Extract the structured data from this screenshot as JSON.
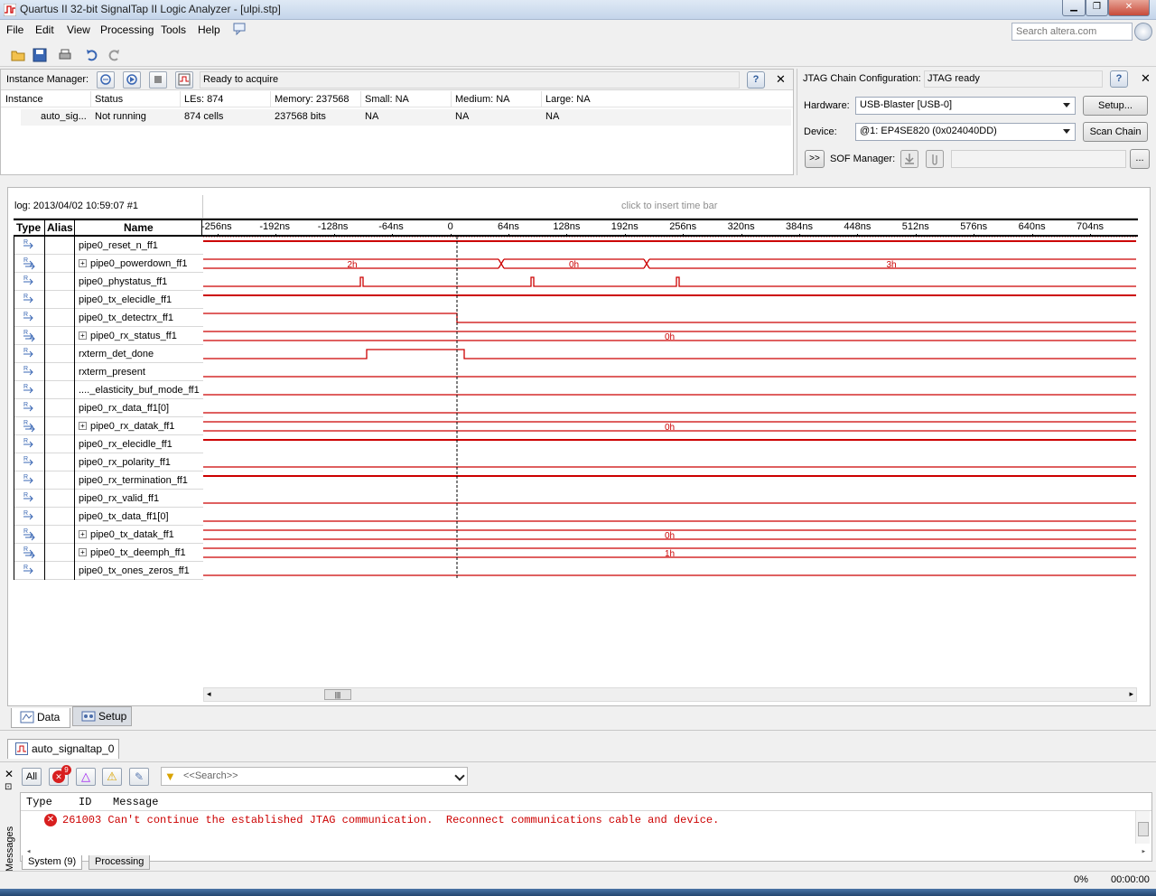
{
  "window": {
    "title": "Quartus II 32-bit SignalTap II Logic Analyzer - [ulpi.stp]",
    "search_placeholder": "Search altera.com"
  },
  "menu": {
    "file": "File",
    "edit": "Edit",
    "view": "View",
    "processing": "Processing",
    "tools": "Tools",
    "help": "Help"
  },
  "instance_manager": {
    "label": "Instance Manager:",
    "status": "Ready to acquire",
    "columns": {
      "instance": "Instance",
      "status": "Status",
      "les": "LEs: 874",
      "memory": "Memory: 237568",
      "small": "Small: NA",
      "medium": "Medium: NA",
      "large": "Large: NA"
    },
    "row": {
      "instance": "auto_sig...",
      "status": "Not running",
      "les": "874 cells",
      "memory": "237568 bits",
      "small": "NA",
      "medium": "NA",
      "large": "NA"
    }
  },
  "jtag": {
    "label": "JTAG Chain Configuration:",
    "status": "JTAG ready",
    "hardware_label": "Hardware:",
    "hardware_value": "USB-Blaster [USB-0]",
    "setup_button": "Setup...",
    "device_label": "Device:",
    "device_value": "@1: EP4SE820 (0x024040DD)",
    "scan_button": "Scan Chain",
    "sof_expand": ">>",
    "sof_label": "SOF Manager:",
    "browse_button": "..."
  },
  "waveform": {
    "log_label": "log: 2013/04/02 10:59:07  #1",
    "timebar_hint": "click to insert time bar",
    "headers": {
      "type": "Type",
      "alias": "Alias",
      "name": "Name"
    },
    "ticks": [
      "-256ns",
      "-192ns",
      "-128ns",
      "-64ns",
      "0",
      "64ns",
      "128ns",
      "192ns",
      "256ns",
      "320ns",
      "384ns",
      "448ns",
      "512ns",
      "576ns",
      "640ns",
      "704ns"
    ],
    "signals": [
      {
        "name": "pipe0_reset_n_ff1",
        "bus": false,
        "wave": "high"
      },
      {
        "name": "pipe0_powerdown_ff1",
        "bus": true,
        "segments": [
          {
            "label": "2h"
          },
          {
            "label": "0h"
          },
          {
            "label": "3h"
          }
        ]
      },
      {
        "name": "pipe0_phystatus_ff1",
        "bus": false,
        "wave": "pulses"
      },
      {
        "name": "pipe0_tx_elecidle_ff1",
        "bus": false,
        "wave": "high"
      },
      {
        "name": "pipe0_tx_detectrx_ff1",
        "bus": false,
        "wave": "high-then-low"
      },
      {
        "name": "pipe0_rx_status_ff1",
        "bus": true,
        "segments": [
          {
            "label": "0h"
          }
        ]
      },
      {
        "name": "rxterm_det_done",
        "bus": false,
        "wave": "pulse-wide"
      },
      {
        "name": "rxterm_present",
        "bus": false,
        "wave": "low"
      },
      {
        "name": "...._elasticity_buf_mode_ff1",
        "bus": false,
        "wave": "low"
      },
      {
        "name": "pipe0_rx_data_ff1[0]",
        "bus": false,
        "wave": "low"
      },
      {
        "name": "pipe0_rx_datak_ff1",
        "bus": true,
        "segments": [
          {
            "label": "0h"
          }
        ]
      },
      {
        "name": "pipe0_rx_elecidle_ff1",
        "bus": false,
        "wave": "high"
      },
      {
        "name": "pipe0_rx_polarity_ff1",
        "bus": false,
        "wave": "low"
      },
      {
        "name": "pipe0_rx_termination_ff1",
        "bus": false,
        "wave": "high"
      },
      {
        "name": "pipe0_rx_valid_ff1",
        "bus": false,
        "wave": "low"
      },
      {
        "name": "pipe0_tx_data_ff1[0]",
        "bus": false,
        "wave": "low"
      },
      {
        "name": "pipe0_tx_datak_ff1",
        "bus": true,
        "segments": [
          {
            "label": "0h"
          }
        ]
      },
      {
        "name": "pipe0_tx_deemph_ff1",
        "bus": true,
        "segments": [
          {
            "label": "1h"
          }
        ]
      },
      {
        "name": "pipe0_tx_ones_zeros_ff1",
        "bus": false,
        "wave": "low"
      }
    ],
    "wave_color": "#cc0000"
  },
  "tabs": {
    "data": "Data",
    "setup": "Setup",
    "instance": "auto_signaltap_0"
  },
  "messages": {
    "side_label": "Messages",
    "filter_all": "All",
    "error_count": "9",
    "search_placeholder": "<<Search>>",
    "columns": {
      "type": "Type",
      "id": "ID",
      "message": "Message"
    },
    "items": [
      {
        "id": "261003",
        "text": "Can't continue the established JTAG communication.  Reconnect communications cable and device."
      }
    ],
    "tab_system": "System (9)",
    "tab_processing": "Processing"
  },
  "statusbar": {
    "progress": "0%",
    "time": "00:00:00"
  }
}
